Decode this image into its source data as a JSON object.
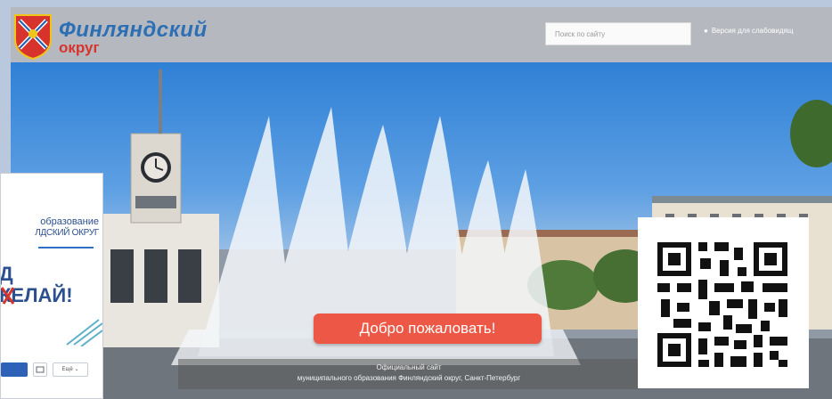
{
  "header": {
    "site_title": "Финляндский",
    "site_subtitle": "округ",
    "search_placeholder": "Поиск по сайту",
    "accessible_version": "Версия для слабовидящ"
  },
  "hero": {
    "welcome_button": "Добро пожаловать!",
    "caption_line1": "Официальный сайт",
    "caption_line2": "муниципального образования Финляндский округ, Санкт-Петербург"
  },
  "side_banner": {
    "line1": "образование",
    "line2": "ЛДСКИЙ ОКРУГ",
    "big1": "Д",
    "big2": "КЕЛАЙ!",
    "primary_button": "",
    "more_button": "Ещё ⌄"
  },
  "colors": {
    "brand_blue": "#2c6fb4",
    "brand_red": "#d6342c",
    "welcome_button": "#ed5846"
  },
  "icons": [
    "coat-of-arms-icon",
    "eye-icon",
    "qr-code-icon",
    "mail-icon",
    "chevron-down-icon"
  ]
}
